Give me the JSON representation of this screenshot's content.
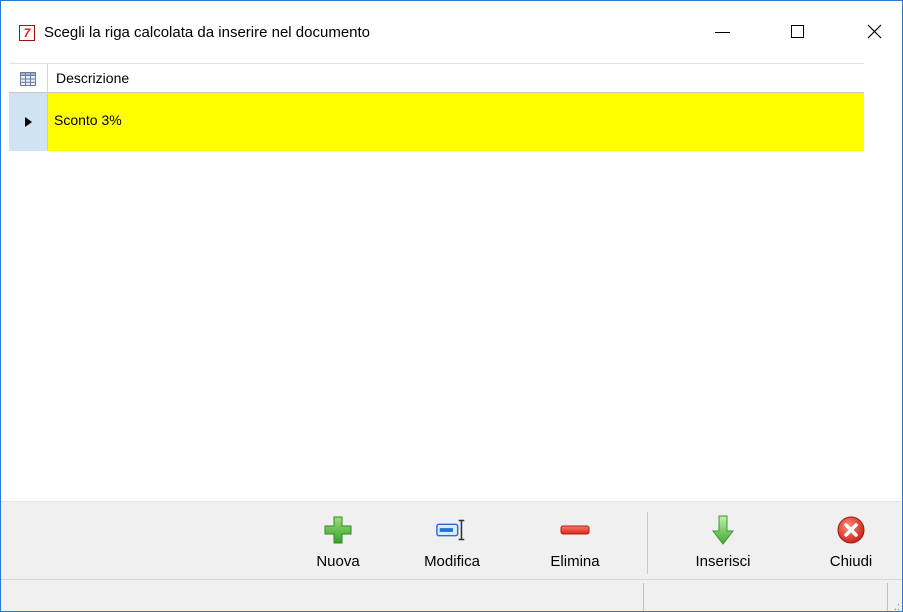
{
  "window": {
    "title": "Scegli la riga calcolata da inserire nel documento",
    "app_icon_glyph": "7",
    "controls": {
      "minimize": "—",
      "maximize": "☐",
      "close": "✕"
    }
  },
  "grid": {
    "columns": [
      {
        "header": "Descrizione"
      }
    ],
    "rows": [
      {
        "descrizione": "Sconto 3%",
        "selected": true
      }
    ],
    "selected_row_color": "#ffff00"
  },
  "toolbar": {
    "buttons": [
      {
        "label": "Nuova",
        "icon": "plus-icon",
        "color": "#4caf50"
      },
      {
        "label": "Modifica",
        "icon": "edit-field-icon",
        "color": "#1e6fd9"
      },
      {
        "label": "Elimina",
        "icon": "minus-icon",
        "color": "#e53935"
      },
      {
        "label": "Inserisci",
        "icon": "arrow-down-icon",
        "color": "#5cbf4a"
      },
      {
        "label": "Chiudi",
        "icon": "close-circle-icon",
        "color": "#e53935"
      }
    ]
  },
  "statusbar": {
    "sections": [
      "",
      ""
    ]
  }
}
